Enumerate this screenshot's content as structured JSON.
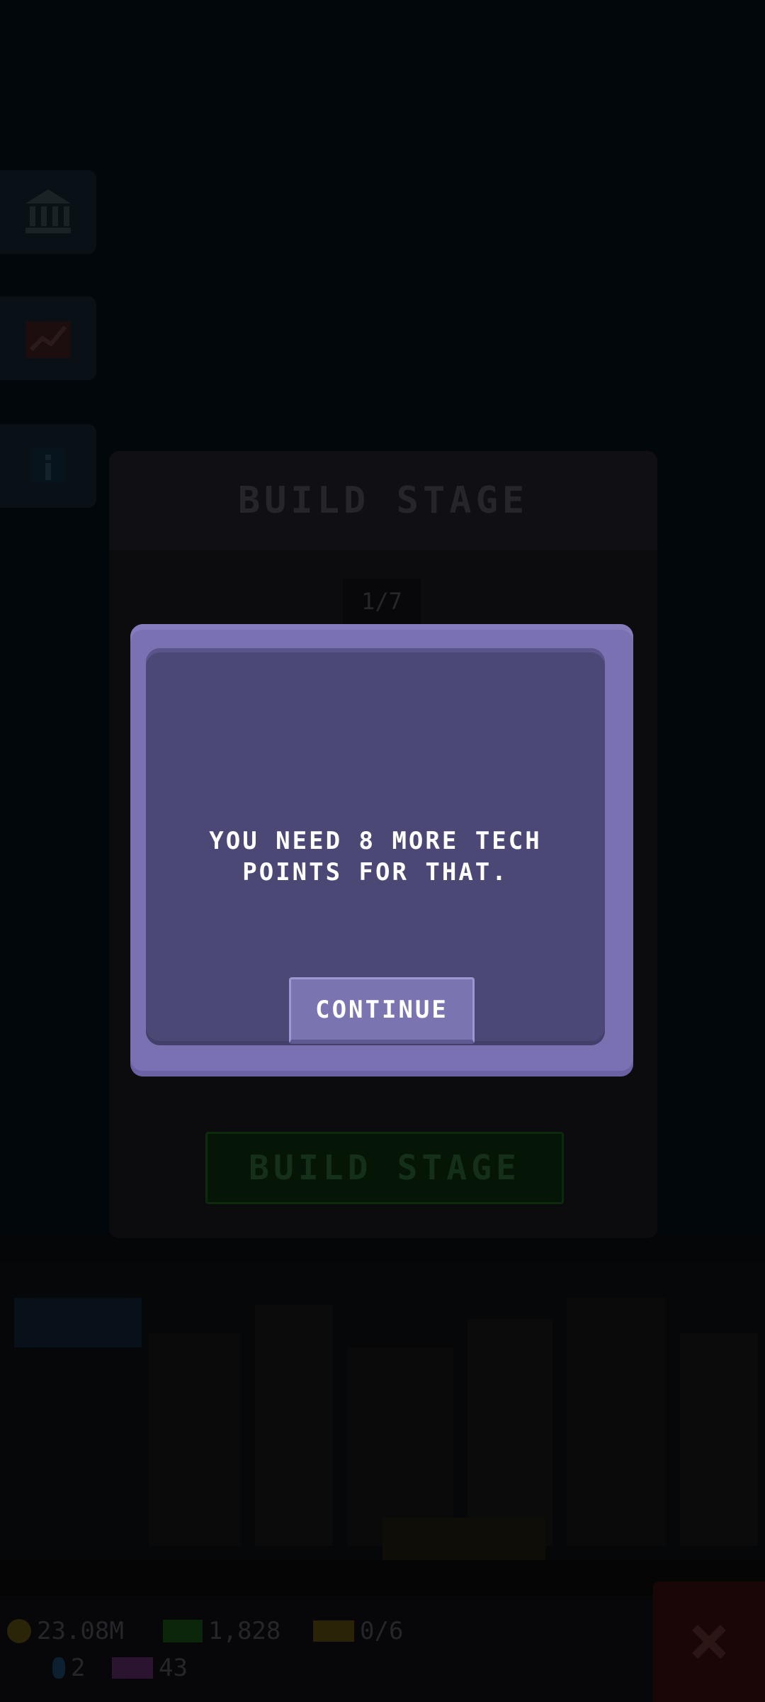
{
  "background": {
    "side_buttons": [
      {
        "icon": "bank-icon"
      },
      {
        "icon": "chart-icon"
      },
      {
        "icon": "info-icon"
      }
    ]
  },
  "build_stage_panel": {
    "title": "BUILD STAGE",
    "page_indicator": "1/7",
    "build_button_label": "BUILD STAGE"
  },
  "status_bar": {
    "coins": "23.08M",
    "cash": "1,828",
    "tickets": "0/6",
    "gems": "2",
    "tech_points": "43"
  },
  "dialog": {
    "message": "YOU NEED 8 MORE TECH POINTS FOR THAT.",
    "continue_label": "CONTINUE"
  },
  "colors": {
    "dialog_frame": "#7a71b3",
    "dialog_body": "#4c4876",
    "continue_button": "#7a74b0",
    "overlay": "#02070b"
  }
}
